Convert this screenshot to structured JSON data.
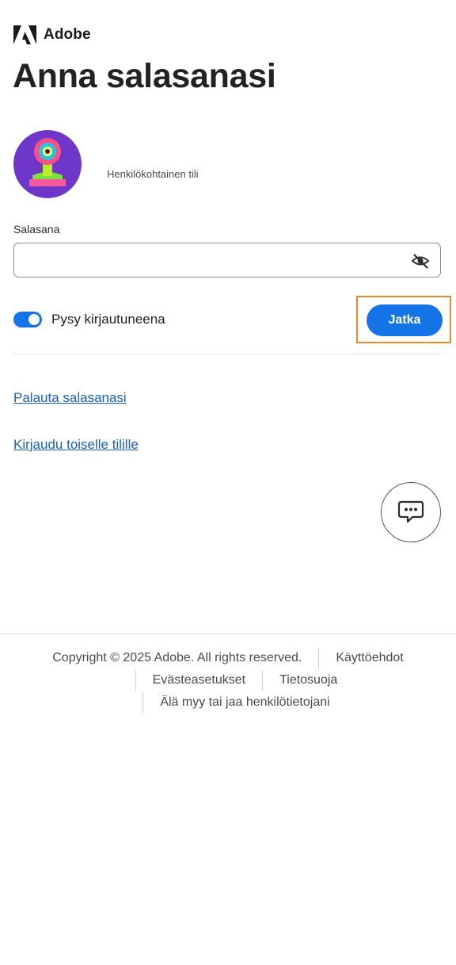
{
  "brand": {
    "name": "Adobe",
    "logo_icon": "adobe-logo-icon"
  },
  "page": {
    "title": "Anna salasanasi"
  },
  "account": {
    "type_label": "Henkilökohtainen tili",
    "avatar": "user-avatar-illustration"
  },
  "password": {
    "label": "Salasana",
    "value": "",
    "placeholder": "",
    "toggle_icon": "eye-slash-icon"
  },
  "stay_signed_in": {
    "label": "Pysy kirjautuneena",
    "enabled": true
  },
  "actions": {
    "continue_label": "Jatka"
  },
  "links": {
    "reset_password": "Palauta salasanasi",
    "other_account": "Kirjaudu toiselle tilille"
  },
  "chat": {
    "icon": "chat-bubble-icon"
  },
  "footer": {
    "copyright": "Copyright © 2025 Adobe. All rights reserved.",
    "terms": "Käyttöehdot",
    "cookies": "Evästeasetukset",
    "privacy": "Tietosuoja",
    "do_not_sell": "Älä myy tai jaa henkilötietojani"
  },
  "colors": {
    "accent": "#1473e6",
    "link": "#1d5fb4",
    "highlight": "#e38a2f",
    "avatar_bg": "#6e37c9"
  }
}
